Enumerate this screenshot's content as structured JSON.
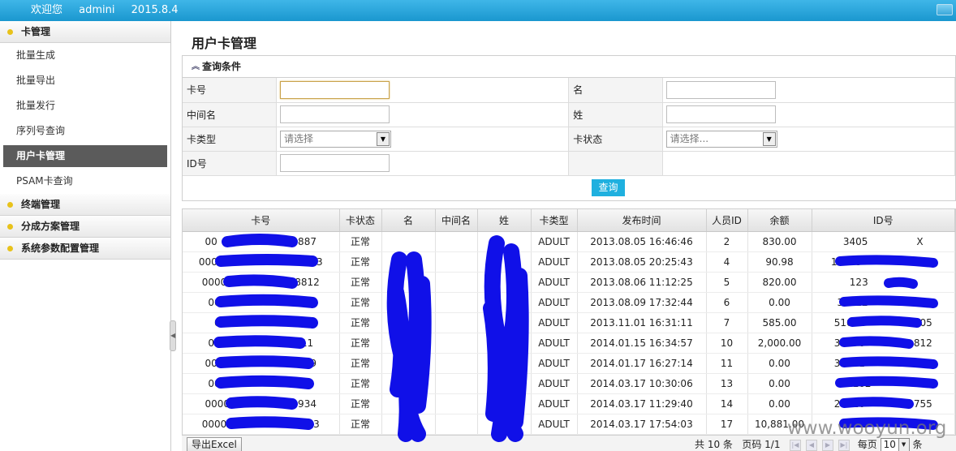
{
  "topbar": {
    "welcome": "欢迎您",
    "user": "admini",
    "date": "2015.8.4"
  },
  "sidebar": {
    "group1": "卡管理",
    "items": [
      "批量生成",
      "批量导出",
      "批量发行",
      "序列号查询",
      "用户卡管理",
      "PSAM卡查询"
    ],
    "groups": [
      "终端管理",
      "分成方案管理",
      "系统参数配置管理"
    ]
  },
  "page": {
    "title": "用户卡管理"
  },
  "query": {
    "header": "查询条件",
    "labels": {
      "card_no": "卡号",
      "first_name": "名",
      "middle_name": "中间名",
      "last_name": "姓",
      "card_type": "卡类型",
      "card_status": "卡状态",
      "id_no": "ID号"
    },
    "card_type_placeholder": "请选择",
    "card_status_placeholder": "请选择...",
    "search_button": "查询"
  },
  "table": {
    "columns": [
      "卡号",
      "卡状态",
      "名",
      "中间名",
      "姓",
      "卡类型",
      "发布时间",
      "人员ID",
      "余额",
      "ID号"
    ],
    "rows": [
      [
        "00",
        "73887",
        "正常",
        "",
        "",
        "",
        "ADULT",
        "2013.08.05 16:46:46",
        "2",
        "830.00",
        "3405",
        "X"
      ],
      [
        "00000",
        "8823",
        "正常",
        "",
        "",
        "",
        "ADULT",
        "2013.08.05 20:25:43",
        "4",
        "90.98",
        "13063",
        "5312"
      ],
      [
        "0000",
        "8812",
        "正常",
        "",
        "",
        "",
        "ADULT",
        "2013.08.06 11:12:25",
        "5",
        "820.00",
        "123",
        ""
      ],
      [
        "000",
        "792",
        "正常",
        "",
        "",
        "",
        "ADULT",
        "2013.08.09 17:32:44",
        "6",
        "0.00",
        "34112",
        "36"
      ],
      [
        "000",
        "4",
        "正常",
        "",
        "",
        "",
        "ADULT",
        "2013.11.01 16:31:11",
        "7",
        "585.00",
        "51011",
        "305"
      ],
      [
        "000",
        "511",
        "正常",
        "",
        "",
        "",
        "ADULT",
        "2014.01.15 16:34:57",
        "10",
        "2,000.00",
        "33070",
        "812"
      ],
      [
        "000",
        "7559",
        "正常",
        "",
        "",
        "",
        "ADULT",
        "2014.01.17 16:27:14",
        "11",
        "0.00",
        "33071",
        "671"
      ],
      [
        "000",
        "748",
        "正常",
        "",
        "",
        "",
        "ADULT",
        "2014.03.17 10:30:06",
        "13",
        "0.00",
        "2102",
        ""
      ],
      [
        "0000",
        "934",
        "正常",
        "",
        "",
        "",
        "ADULT",
        "2014.03.17 11:29:40",
        "14",
        "0.00",
        "21020",
        "755"
      ],
      [
        "00000",
        "023",
        "正常",
        "",
        "",
        "",
        "ADULT",
        "2014.03.17 17:54:03",
        "17",
        "10,881.00",
        "4211",
        "9"
      ]
    ]
  },
  "pager": {
    "export": "导出Excel",
    "total": "共 10 条",
    "page_label": "页码 1/1",
    "per_page": "每页",
    "per_page_value": "10",
    "unit": "条"
  },
  "watermark": "www.wooyun.org"
}
